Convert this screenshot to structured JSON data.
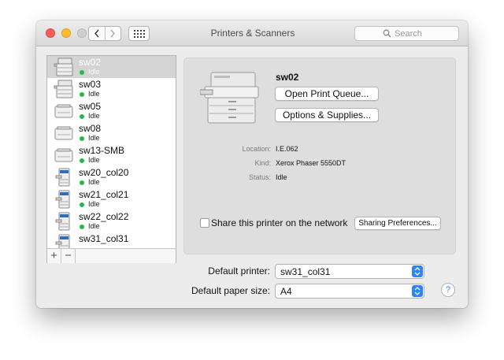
{
  "window": {
    "title": "Printers & Scanners",
    "search_placeholder": "Search"
  },
  "printers": [
    {
      "name": "sw02",
      "status": "Idle",
      "icon": "printer-large-icon",
      "selected": true
    },
    {
      "name": "sw03",
      "status": "Idle",
      "icon": "printer-large-icon"
    },
    {
      "name": "sw05",
      "status": "Idle",
      "icon": "printer-desktop-icon"
    },
    {
      "name": "sw08",
      "status": "Idle",
      "icon": "printer-desktop-icon"
    },
    {
      "name": "sw13-SMB",
      "status": "Idle",
      "icon": "printer-desktop-icon"
    },
    {
      "name": "sw20_col20",
      "status": "Idle",
      "icon": "color-printer-icon"
    },
    {
      "name": "sw21_col21",
      "status": "Idle",
      "icon": "color-printer-icon"
    },
    {
      "name": "sw22_col22",
      "status": "Idle",
      "icon": "color-printer-icon"
    },
    {
      "name": "sw31_col31",
      "status": "",
      "icon": "color-printer-icon"
    }
  ],
  "list_footer": {
    "add": "+",
    "remove": "−"
  },
  "detail": {
    "name": "sw02",
    "open_queue": "Open Print Queue...",
    "options_supplies": "Options & Supplies...",
    "location_label": "Location:",
    "location": "I.E.062",
    "kind_label": "Kind:",
    "kind": "Xerox Phaser 5550DT",
    "status_label": "Status:",
    "status": "Idle",
    "share_label": "Share this printer on the network",
    "share_checked": false,
    "sharing_prefs": "Sharing Preferences..."
  },
  "defaults": {
    "printer_label": "Default printer:",
    "printer_value": "sw31_col31",
    "paper_label": "Default paper size:",
    "paper_value": "A4"
  },
  "help": "?",
  "colors": {
    "accent": "#2c84f5",
    "status_idle": "#27b847",
    "close": "#fc5f57",
    "minimize": "#fdbc2e"
  }
}
